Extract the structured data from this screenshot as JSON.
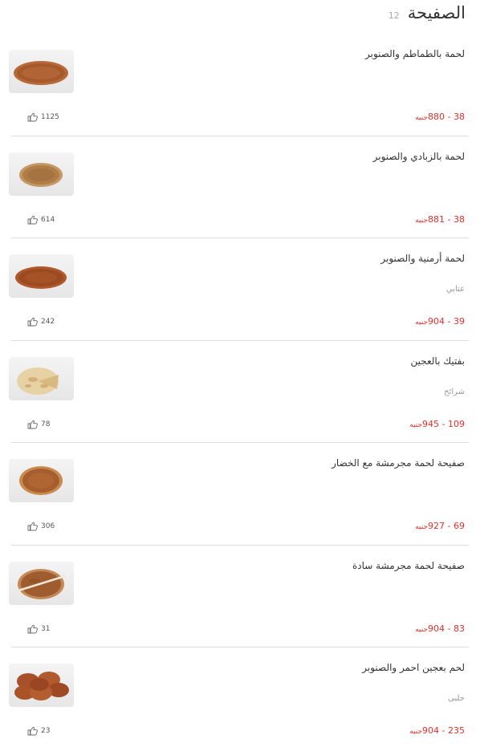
{
  "header": {
    "title": "الصفيحة",
    "count": "12"
  },
  "items": [
    {
      "name": "لحمة بالطماطم والصنوبر",
      "description": "",
      "price_range": "38 - 880",
      "currency": "جنيه",
      "likes": "1125",
      "image": "oval-flatbread"
    },
    {
      "name": "لحمة بالزبادي والصنوبر",
      "description": "",
      "price_range": "38 - 881",
      "currency": "جنيه",
      "likes": "614",
      "image": "oval-flatbread-light"
    },
    {
      "name": "لحمة أرمنية والصنوبر",
      "description": "عتابي",
      "price_range": "39 - 904",
      "currency": "جنيه",
      "likes": "242",
      "image": "oval-flatbread-dark"
    },
    {
      "name": "بفتيك بالعجين",
      "description": "شرائح",
      "price_range": "109 - 945",
      "currency": "جنيه",
      "likes": "78",
      "image": "cut-flatbread"
    },
    {
      "name": "صفيحة لحمة مجرمشة مع الخضار",
      "description": "",
      "price_range": "69 - 927",
      "currency": "جنيه",
      "likes": "306",
      "image": "round-flatbread"
    },
    {
      "name": "صفيحة لحمة مجرمشة سادة",
      "description": "",
      "price_range": "83 - 904",
      "currency": "جنيه",
      "likes": "31",
      "image": "sliced-flatbread"
    },
    {
      "name": "لحم بعجين احمر والصنوبر",
      "description": "حلبى",
      "price_range": "235 - 904",
      "currency": "جنيه",
      "likes": "23",
      "image": "stacked-flatbreads"
    }
  ],
  "colors": {
    "price": "#e0302b",
    "divider": "#dddddd",
    "muted": "#999999"
  },
  "icons": {
    "like": "thumbs-up-icon"
  }
}
